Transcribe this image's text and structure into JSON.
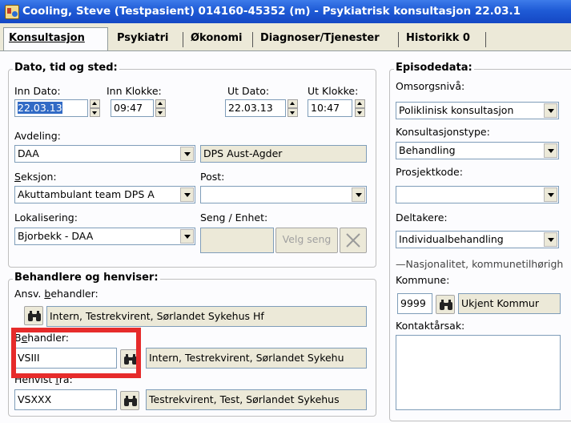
{
  "window": {
    "title": "Cooling, Steve (Testpasient) 014160-45352 (m) - Psykiatrisk konsultasjon 22.03.1"
  },
  "tabs": [
    {
      "label": "Konsultasjon",
      "active": true
    },
    {
      "label": "Psykiatri",
      "active": false
    },
    {
      "label": "Økonomi",
      "active": false
    },
    {
      "label": "Diagnoser/Tjenester",
      "active": false
    },
    {
      "label": "Historikk 0",
      "active": false
    }
  ],
  "dato_group": {
    "title": "Dato, tid og sted:",
    "inn_dato_label": "Inn Dato:",
    "inn_dato_value": "22.03.13",
    "inn_klokke_label": "Inn Klokke:",
    "inn_klokke_value": "09:47",
    "ut_dato_label": "Ut Dato:",
    "ut_dato_value": "22.03.13",
    "ut_klokke_label": "Ut Klokke:",
    "ut_klokke_value": "10:47",
    "avdeling_label": "Avdeling:",
    "avdeling_value": "DAA",
    "avdeling_name": "DPS Aust-Agder",
    "seksjon_label": "Seksjon:",
    "seksjon_value": "Akuttambulant team DPS A",
    "post_label": "Post:",
    "post_value": "",
    "lokalisering_label": "Lokalisering:",
    "lokalisering_value": "Bjorbekk - DAA",
    "seng_label": "Seng / Enhet:",
    "seng_value": "",
    "velg_seng_label": "Velg seng"
  },
  "behandlere_group": {
    "title": "Behandlere og henviser:",
    "ansv_label": "Ansv. behandler:",
    "ansv_value": "Intern, Testrekvirent, Sørlandet Sykehus Hf",
    "behandler_label": "Behandler:",
    "behandler_code": "VSIII",
    "behandler_name": "Intern, Testrekvirent, Sørlandet Sykehu",
    "henvist_label": "Henvist fra:",
    "henvist_code": "VSXXX",
    "henvist_name": "Testrekvirent, Test, Sørlandet Sykehus"
  },
  "episode_group": {
    "title": "Episodedata:",
    "omsorg_label": "Omsorgsnivå:",
    "omsorg_value": "Poliklinisk konsultasjon",
    "konstype_label": "Konsultasjonstype:",
    "konstype_value": "Behandling",
    "prosjekt_label": "Prosjektkode:",
    "prosjekt_value": "",
    "deltakere_label": "Deltakere:",
    "deltakere_value": "Individualbehandling",
    "nasjonalitet_label": "Nasjonalitet, kommunetilhørigh",
    "kommune_label": "Kommune:",
    "kommune_code": "9999",
    "kommune_name": "Ukjent Kommur",
    "kontakt_label": "Kontaktårsak:",
    "kontakt_value": ""
  },
  "colors": {
    "titlebar": "#1f5bd6",
    "selection": "#316ac5",
    "highlight_box": "#e62b2b"
  },
  "icons": [
    "app-icon",
    "binoculars-icon",
    "close-x-icon",
    "dropdown-arrow-icon",
    "spin-up-icon",
    "spin-down-icon"
  ]
}
